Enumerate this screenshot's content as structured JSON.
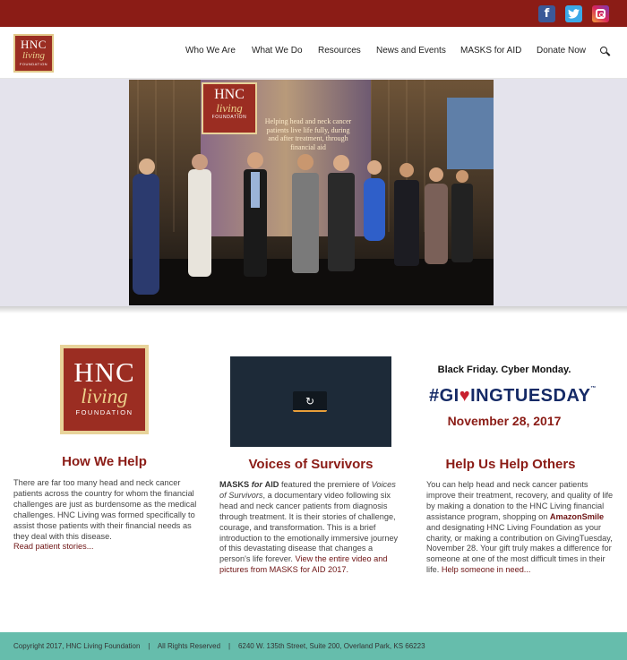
{
  "social": {
    "facebook_icon": "facebook-icon",
    "twitter_icon": "twitter-icon",
    "instagram_icon": "instagram-icon"
  },
  "logo": {
    "line1": "HNC",
    "line2": "living",
    "line3": "FOUNDATION"
  },
  "nav": {
    "items": [
      "Who We Are",
      "What We Do",
      "Resources",
      "News and Events",
      "MASKS for AID",
      "Donate Now"
    ],
    "search_icon": "search-icon"
  },
  "hero": {
    "banner_line1": "HNC",
    "banner_line2": "living",
    "banner_line3": "FOUNDATION",
    "banner_tagline": "Helping head and neck cancer patients live life fully, during and after treatment, through financial aid"
  },
  "col1": {
    "title": "How We Help",
    "text": "There are far too many head and neck cancer patients across the country for whom the financial challenges are just as burdensome as the medical challenges. HNC Living was formed specifically to assist those patients with their financial needs as they deal with this disease.",
    "link": "Read patient stories..."
  },
  "col2": {
    "title": "Voices of Survivors",
    "masks": "MASKS",
    "for_word": "for",
    "aid": "AID",
    "text1": " featured the premiere of ",
    "voices_italic": "Voices of Survivors",
    "text2": ", a documentary video following six head and neck cancer patients from diagnosis through treatment. It is their stories of challenge, courage, and transformation. This is a brief introduction to the emotionally immersive journey of this devastating disease that changes a person's life forever. ",
    "link": "View the entire video and pictures from MASKS for AID 2017.",
    "replay_icon": "replay-icon"
  },
  "col3": {
    "headline": "Black Friday. Cyber Monday.",
    "giving_prefix": "#GI",
    "giving_suffix": "INGTUESDAY",
    "heart_icon": "heart-icon",
    "date": "November 28, 2017",
    "title": "Help Us Help Others",
    "text1": "You can help head and neck cancer patients improve their treatment, recovery, and quality of life by making a donation to the HNC Living financial assistance program, shopping on ",
    "amazon": "AmazonSmile",
    "text2": " and designating HNC Living Foundation as your charity, or making a contribution on GivingTuesday, November 28. Your gift truly makes a difference for someone at one of the most difficult times in their life. ",
    "link": "Help someone in need..."
  },
  "footer": {
    "text": "Copyright 2017, HNC Living Foundation    |    All Rights Reserved    |    6240 W. 135th Street, Suite 200, Overland Park, KS 66223"
  },
  "colors": {
    "brand_red": "#8b1c16",
    "footer_teal": "#66bdac",
    "giving_navy": "#152a66"
  }
}
